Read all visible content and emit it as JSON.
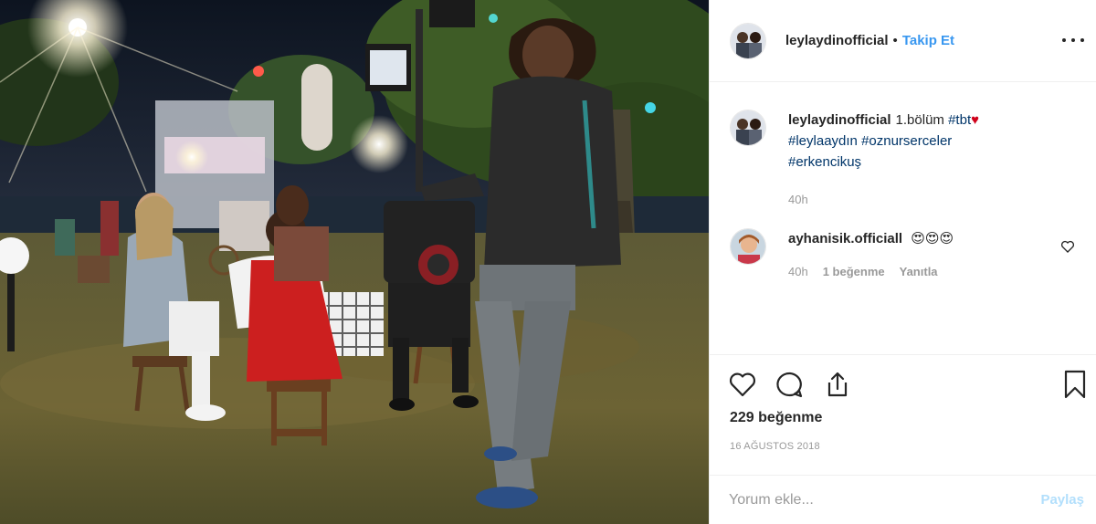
{
  "header": {
    "username": "leylaydinofficial",
    "separator": "•",
    "follow_label": "Takip Et",
    "more_icon": "more-horizontal-icon"
  },
  "caption": {
    "username": "leylaydinofficial",
    "text": "1.bölüm",
    "tags": [
      "#tbt",
      "#leylaaydın",
      "#oznurserceler",
      "#erkencikuş"
    ],
    "heart": "♥",
    "time": "40h"
  },
  "reply": {
    "username": "ayhanisik.officiall",
    "text": "😍😍😍",
    "time": "40h",
    "likes_label": "1 beğenme",
    "reply_label": "Yanıtla"
  },
  "actions": {
    "like_icon": "heart-icon",
    "comment_icon": "comment-icon",
    "share_icon": "share-icon",
    "save_icon": "bookmark-icon",
    "likes_count": "229 beğenme",
    "date": "16 AĞUSTOS 2018"
  },
  "comment_box": {
    "placeholder": "Yorum ekle...",
    "post_label": "Paylaş"
  },
  "colors": {
    "link": "#3897f0",
    "tag": "#003569",
    "muted": "#999999",
    "heart": "#d0021b",
    "post_disabled": "#b2dffc"
  }
}
